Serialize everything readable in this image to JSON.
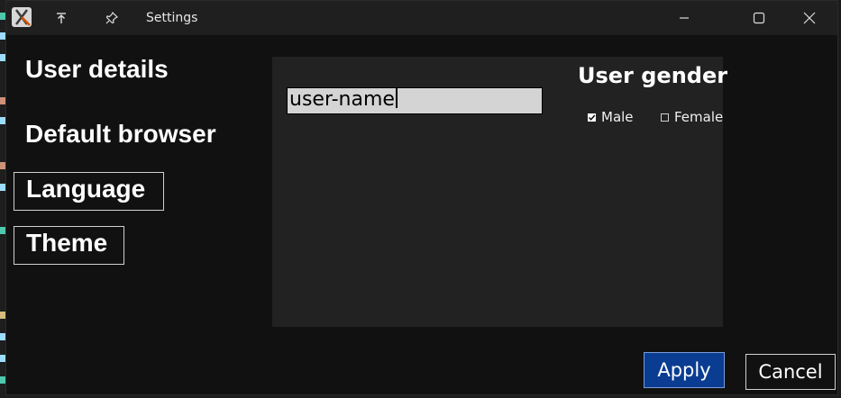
{
  "window": {
    "title": "Settings"
  },
  "nav": {
    "items": [
      {
        "label": "User details"
      },
      {
        "label": "Default browser"
      },
      {
        "label": "Language"
      },
      {
        "label": "Theme"
      }
    ]
  },
  "user_panel": {
    "username_value": "user-name",
    "gender": {
      "title": "User gender",
      "options": [
        {
          "label": "Male",
          "checked": true
        },
        {
          "label": "Female",
          "checked": false
        }
      ]
    }
  },
  "actions": {
    "apply_label": "Apply",
    "cancel_label": "Cancel"
  },
  "colors": {
    "apply_background": "#0a3d91",
    "panel_background": "#222222",
    "window_background": "#111111"
  }
}
